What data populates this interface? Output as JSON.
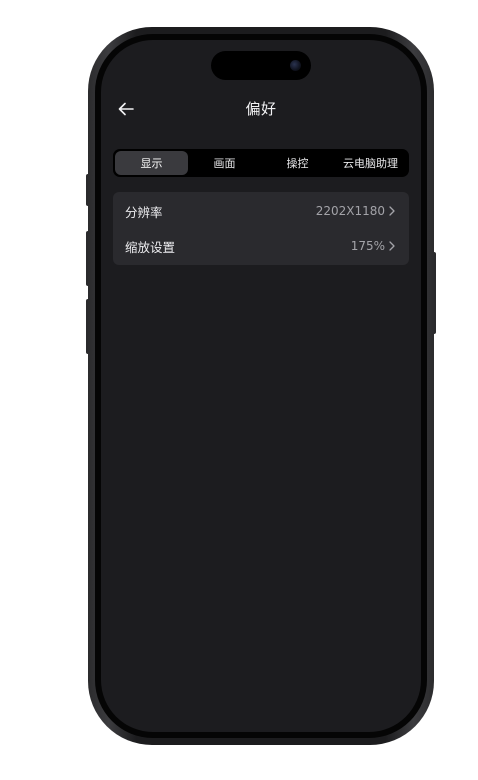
{
  "header": {
    "title": "偏好"
  },
  "tabs": [
    {
      "label": "显示",
      "active": true
    },
    {
      "label": "画面",
      "active": false
    },
    {
      "label": "操控",
      "active": false
    },
    {
      "label": "云电脑助理",
      "active": false
    }
  ],
  "settings": [
    {
      "label": "分辨率",
      "value": "2202X1180"
    },
    {
      "label": "缩放设置",
      "value": "175%"
    }
  ],
  "icons": {
    "back": "back-arrow-icon",
    "chevron": "chevron-right-icon"
  },
  "colors": {
    "screen_bg": "#1c1c1f",
    "card_bg": "#2a2a2e",
    "tab_bar_bg": "#000000",
    "tab_active_bg": "#3a3a3e"
  }
}
